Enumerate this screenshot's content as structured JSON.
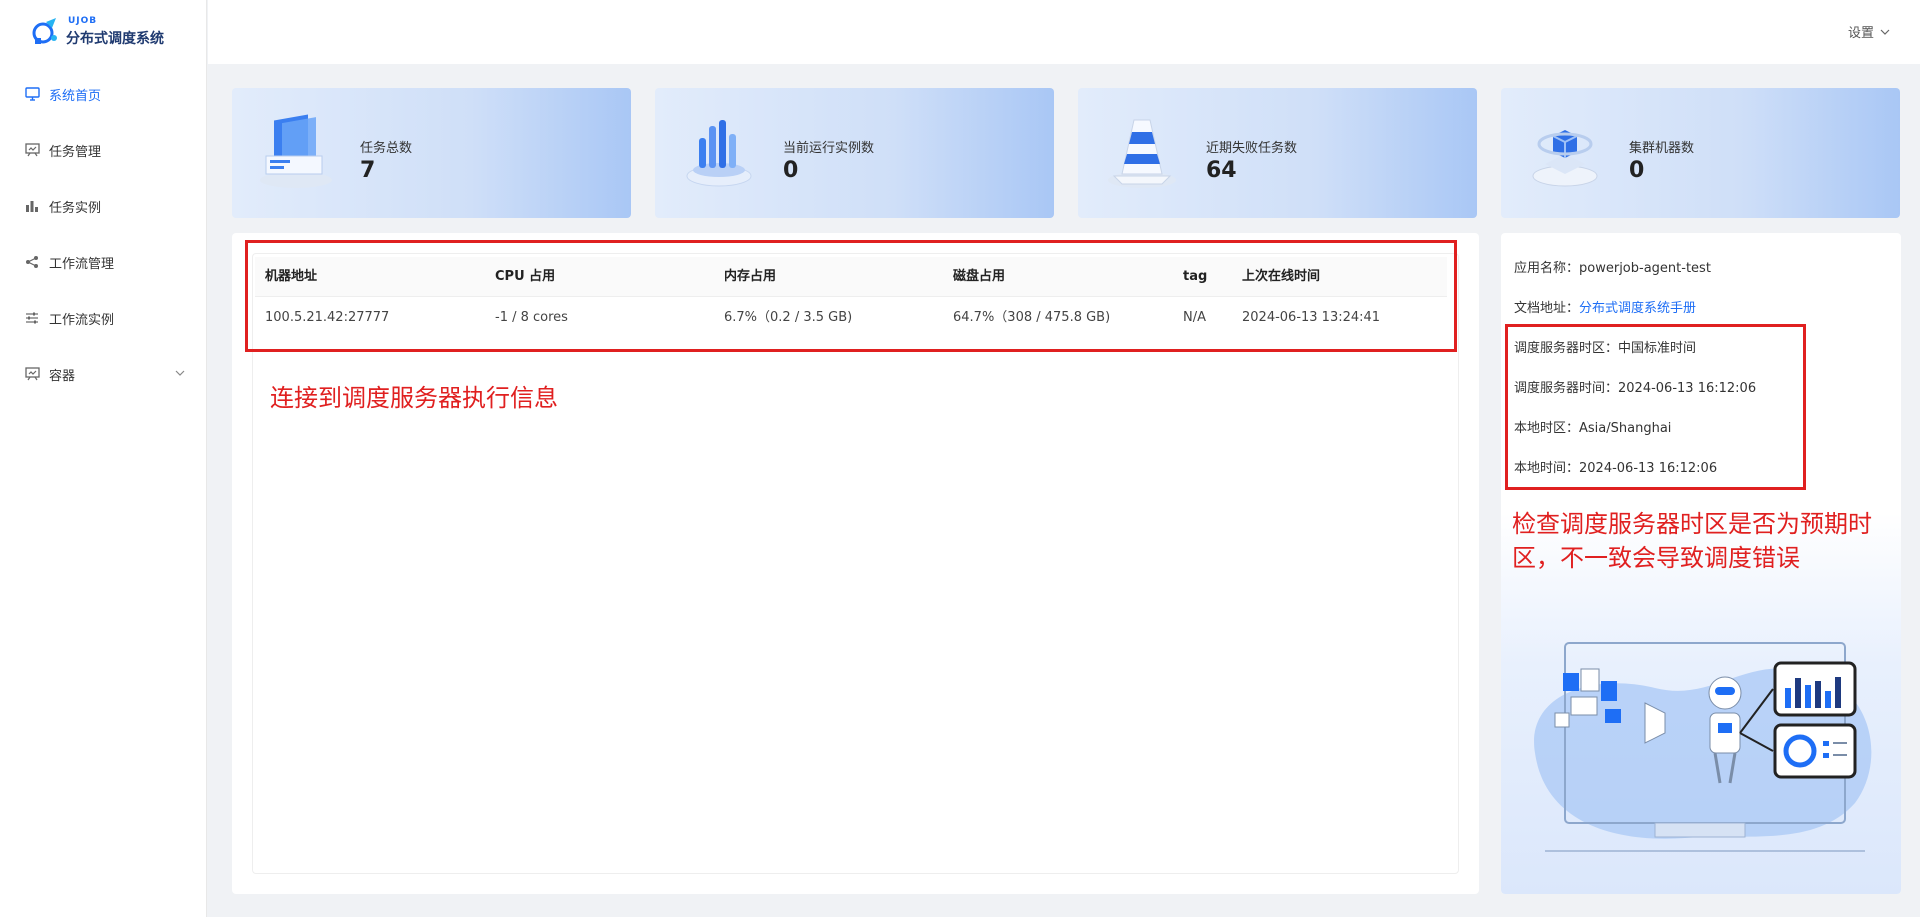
{
  "app": {
    "logo_small": "UJOB",
    "logo_text": "分布式调度系统"
  },
  "header": {
    "settings_label": "设置"
  },
  "sidebar": {
    "items": [
      {
        "label": "系统首页",
        "icon": "monitor-icon",
        "active": true
      },
      {
        "label": "任务管理",
        "icon": "board-icon"
      },
      {
        "label": "任务实例",
        "icon": "bar-chart-icon"
      },
      {
        "label": "工作流管理",
        "icon": "share-icon"
      },
      {
        "label": "工作流实例",
        "icon": "sliders-icon"
      },
      {
        "label": "容器",
        "icon": "board-icon",
        "expandable": true
      }
    ]
  },
  "stats": [
    {
      "label": "任务总数",
      "value": "7"
    },
    {
      "label": "当前运行实例数",
      "value": "0"
    },
    {
      "label": "近期失败任务数",
      "value": "64"
    },
    {
      "label": "集群机器数",
      "value": "0"
    }
  ],
  "table": {
    "columns": [
      "机器地址",
      "CPU 占用",
      "内存占用",
      "磁盘占用",
      "tag",
      "上次在线时间"
    ],
    "rows": [
      [
        "100.5.21.42:27777",
        "-1 / 8 cores",
        "6.7%（0.2 / 3.5 GB)",
        "64.7%（308 / 475.8 GB)",
        "N/A",
        "2024-06-13 13:24:41"
      ]
    ]
  },
  "annotations": {
    "table_note": "连接到调度服务器执行信息",
    "timezone_note": "检查调度服务器时区是否为预期时区，不一致会导致调度错误"
  },
  "info": {
    "app_name_label": "应用名称：",
    "app_name": "powerjob-agent-test",
    "doc_label": "文档地址：",
    "doc_link": "分布式调度系统手册",
    "server_tz_label": "调度服务器时区：",
    "server_tz": "中国标准时间",
    "server_time_label": "调度服务器时间：",
    "server_time": "2024-06-13 16:12:06",
    "local_tz_label": "本地时区：",
    "local_tz": "Asia/Shanghai",
    "local_time_label": "本地时间：",
    "local_time": "2024-06-13 16:12:06"
  },
  "colors": {
    "accent": "#1e6ef5",
    "annotation": "#e02020"
  }
}
